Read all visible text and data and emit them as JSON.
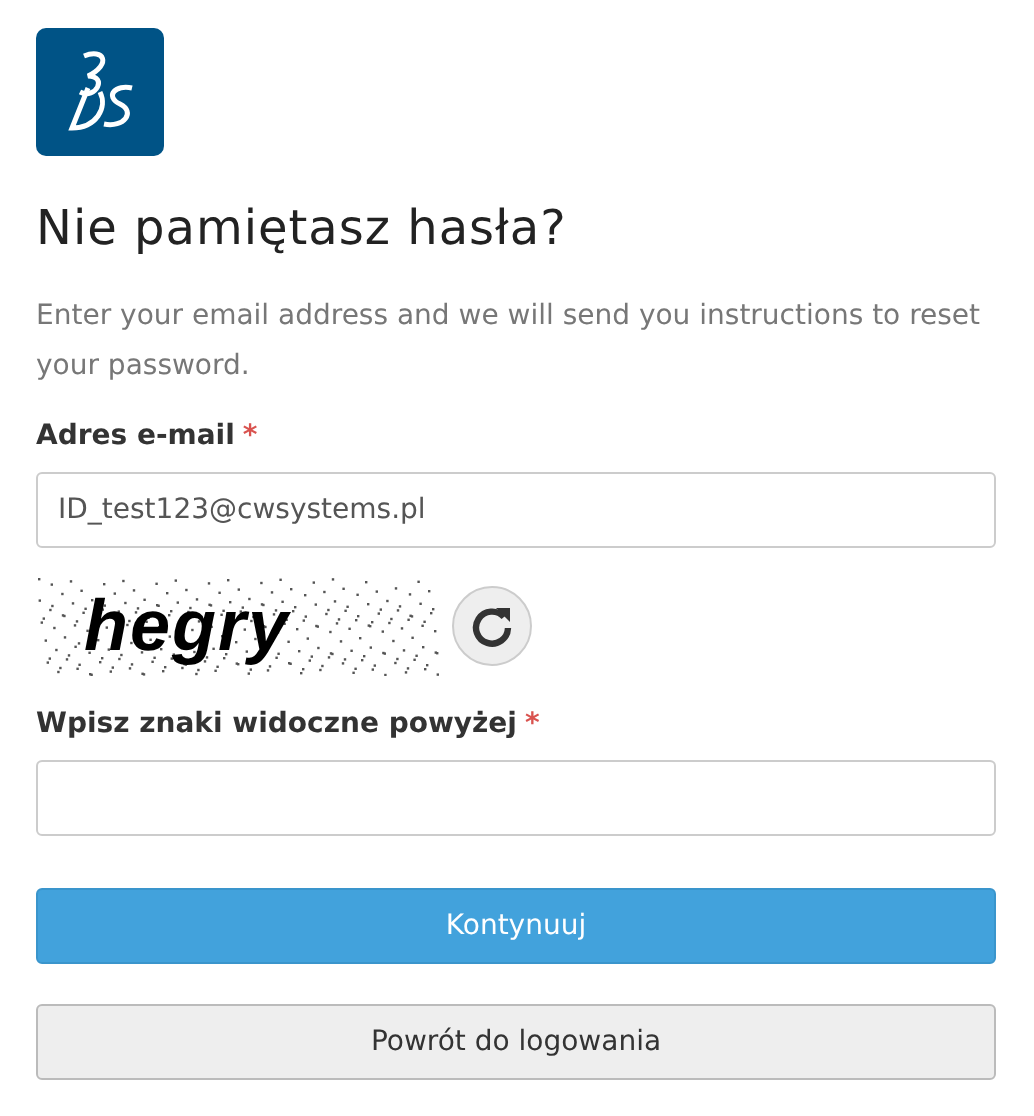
{
  "title": "Nie pamiętasz hasła?",
  "description": "Enter your email address and we will send you instructions to reset your password.",
  "email": {
    "label": "Adres e-mail",
    "required_marker": "*",
    "value": "ID_test123@cwsystems.pl"
  },
  "captcha": {
    "text": "hegry"
  },
  "captcha_field": {
    "label": "Wpisz znaki widoczne powyżej",
    "required_marker": "*"
  },
  "buttons": [
    {
      "label": "Kontynuuj",
      "kind": "primary"
    },
    {
      "label": "Powrót do logowania",
      "kind": "secondary"
    }
  ]
}
